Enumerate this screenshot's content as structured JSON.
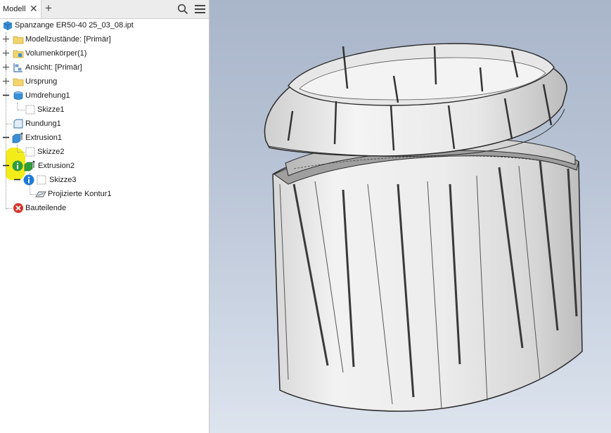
{
  "panel": {
    "tab_label": "Modell",
    "close_glyph": "✕",
    "add_glyph": "+"
  },
  "tree": {
    "root": "Spanzange ER50-40 25_03_08.ipt",
    "items": [
      {
        "label": "Modellzustände: [Primär]",
        "icon": "folder-icon"
      },
      {
        "label": "Volumenkörper(1)",
        "icon": "folder-icon"
      },
      {
        "label": "Ansicht: [Primär]",
        "icon": "view-icon"
      },
      {
        "label": "Ursprung",
        "icon": "folder-icon"
      },
      {
        "label": "Umdrehung1",
        "icon": "revolve-icon"
      },
      {
        "label": "Skizze1",
        "icon": "sketch-icon"
      },
      {
        "label": "Rundung1",
        "icon": "fillet-icon"
      },
      {
        "label": "Extrusion1",
        "icon": "extrude-icon"
      },
      {
        "label": "Skizze2",
        "icon": "sketch-icon"
      },
      {
        "label": "Extrusion2",
        "icon": "extrude-icon",
        "status": "info-icon"
      },
      {
        "label": "Skizze3",
        "icon": "sketch-icon",
        "status": "info-icon"
      },
      {
        "label": "Projizierte Kontur1",
        "icon": "projected-contour-icon"
      },
      {
        "label": "Bauteilende",
        "icon": "end-of-part-error-icon"
      }
    ]
  },
  "colors": {
    "info_green": "#2e9e3a",
    "info_blue": "#1f7ad6",
    "error_red": "#d9342b",
    "highlight": "#f2ea00",
    "part_blue": "#3a8fd6"
  }
}
